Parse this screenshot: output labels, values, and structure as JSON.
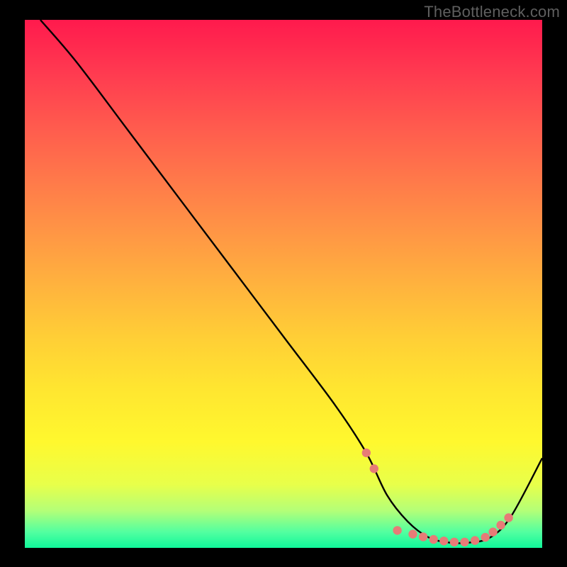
{
  "watermark": "TheBottleneck.com",
  "chart_data": {
    "type": "line",
    "title": "",
    "xlabel": "",
    "ylabel": "",
    "xlim": [
      0,
      100
    ],
    "ylim": [
      0,
      100
    ],
    "grid": false,
    "legend": false,
    "series": [
      {
        "name": "bottleneck-curve",
        "color": "#000000",
        "x": [
          3,
          10,
          20,
          30,
          40,
          50,
          60,
          66,
          70,
          74,
          78,
          82,
          86,
          90,
          94,
          100
        ],
        "y": [
          100,
          92,
          79,
          66,
          53,
          40,
          27,
          18,
          10,
          5,
          2,
          1,
          1,
          2,
          6,
          17
        ]
      }
    ],
    "markers": [
      {
        "name": "highlight-dots",
        "color": "#e77b77",
        "x": [
          66,
          67.5,
          72,
          75,
          77,
          79,
          81,
          83,
          85,
          87,
          89,
          90.5,
          92,
          93.5
        ],
        "y": [
          18,
          15,
          3.3,
          2.6,
          2.1,
          1.6,
          1.3,
          1.1,
          1.1,
          1.4,
          2.0,
          3.0,
          4.3,
          5.7
        ]
      }
    ],
    "background_gradient": {
      "top": "#ff1a4d",
      "mid": "#ffe630",
      "bottom": "#10f79a"
    }
  }
}
